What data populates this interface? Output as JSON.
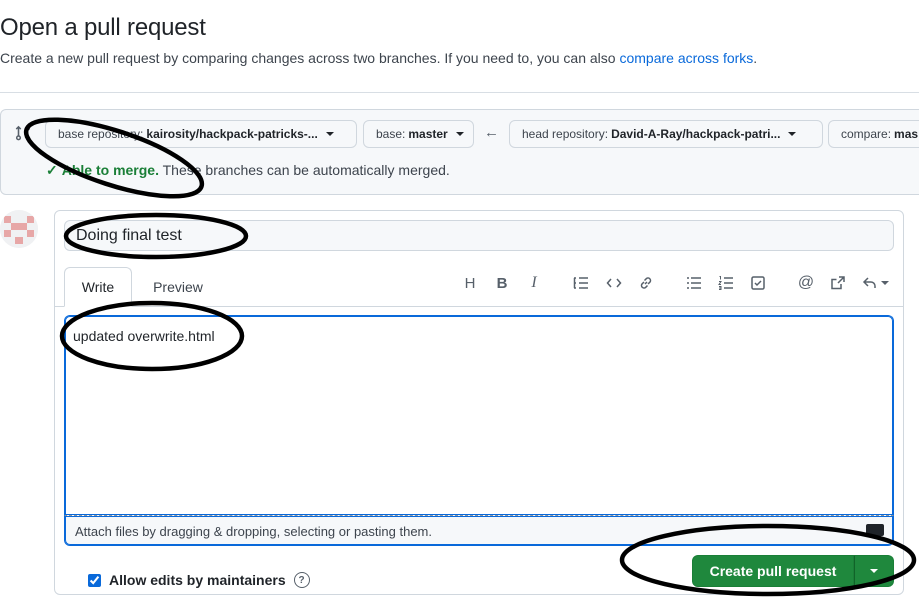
{
  "header": {
    "title": "Open a pull request",
    "subtitle": "Create a new pull request by comparing changes across two branches. If you need to, you can also ",
    "subtitle_link": "compare across forks",
    "subtitle_end": "."
  },
  "compare": {
    "base_repo_label": "base repository:",
    "base_repo_value": "kairosity/hackpack-patricks-...",
    "base_label": "base:",
    "base_value": "master",
    "head_repo_label": "head repository:",
    "head_repo_value": "David-A-Ray/hackpack-patri...",
    "compare_label": "compare:",
    "compare_value": "mas",
    "merge_ok": "Able to merge.",
    "merge_text": " These branches can be automatically merged."
  },
  "form": {
    "title_value": "Doing final test",
    "tabs": [
      {
        "label": "Write"
      },
      {
        "label": "Preview"
      }
    ],
    "toolbar": {
      "heading": "H",
      "bold": "B",
      "italic": "I",
      "mention": "@"
    },
    "body_value": "updated overwrite.html",
    "attach_text": "Attach files by dragging & dropping, selecting or pasting them.",
    "allow_edits_label": "Allow edits by maintainers",
    "help": "?",
    "create_button": "Create pull request"
  },
  "colors": {
    "accent_blue": "#0969da",
    "success_green": "#1a7f37",
    "button_green": "#1f883d",
    "annotation_ink": "#000000"
  }
}
